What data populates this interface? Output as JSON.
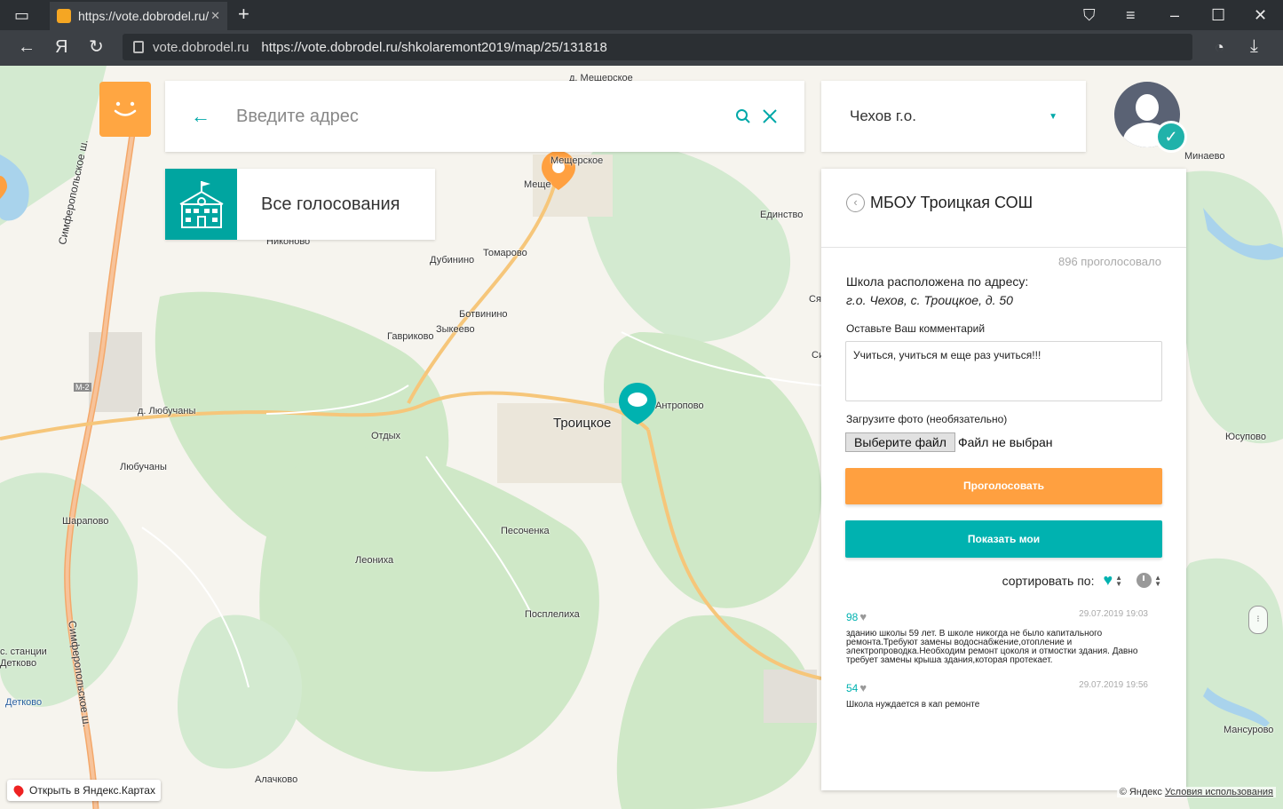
{
  "browser": {
    "tab_title": "https://vote.dobrodel.ru/",
    "tab_close": "✕",
    "new_tab": "+",
    "domain": "vote.dobrodel.ru",
    "url": "https://vote.dobrodel.ru/shkolaremont2019/map/25/131818",
    "yandex_glyph": "Я"
  },
  "search": {
    "placeholder": "Введите адрес",
    "back_glyph": "←"
  },
  "district": {
    "value": "Чехов г.о."
  },
  "all_votes": {
    "label": "Все голосования"
  },
  "panel": {
    "title": "МБОУ Троицкая СОШ",
    "vote_count": "896 проголосовало",
    "address_label": "Школа расположена по адресу:",
    "address_value": "г.о. Чехов, с. Троицкое, д. 50",
    "comment_label": "Оставьте Ваш комментарий",
    "comment_value": "Учиться, учиться м еще раз учиться!!!",
    "photo_label": "Загрузите фото (необязательно)",
    "file_button": "Выберите файл",
    "file_status": "Файл не выбран",
    "vote_button": "Проголосовать",
    "show_mine_button": "Показать мои",
    "sort_label": "сортировать по:"
  },
  "comments": [
    {
      "count": "98",
      "date": "29.07.2019 19:03",
      "text": "зданию школы 59 лет. В школе никогда не было капитального ремонта.Требуют замены водоснабжение,отопление и электропроводка.Необходим ремонт цоколя и отмостки здания. Давно требует замены крыша здания,которая протекает."
    },
    {
      "count": "54",
      "date": "29.07.2019 19:56",
      "text": "Школа нуждается в кап ремонте"
    }
  ],
  "map": {
    "places": [
      {
        "name": "д. Мещерское"
      },
      {
        "name": "Мещерское"
      },
      {
        "name": "Меще"
      },
      {
        "name": "Никоново"
      },
      {
        "name": "Дубинино"
      },
      {
        "name": "Томарово"
      },
      {
        "name": "Ботвинино"
      },
      {
        "name": "Гавриково"
      },
      {
        "name": "Зыкеево"
      },
      {
        "name": "Антропово"
      },
      {
        "name": "д. Любучаны"
      },
      {
        "name": "Любучаны"
      },
      {
        "name": "Отдых"
      },
      {
        "name": "Троицкое"
      },
      {
        "name": "Шарапово"
      },
      {
        "name": "Песоченка"
      },
      {
        "name": "Леониха"
      },
      {
        "name": "Посплелиха"
      },
      {
        "name": "с. станции"
      },
      {
        "name": "Детково"
      },
      {
        "name": "Детково"
      },
      {
        "name": "Алачково"
      },
      {
        "name": "Минаево"
      },
      {
        "name": "Единство"
      },
      {
        "name": "Юсупово"
      },
      {
        "name": "Мансурово"
      },
      {
        "name": "Ся"
      },
      {
        "name": "Си"
      },
      {
        "name": "Симферопольское ш."
      },
      {
        "name": "Симферопольское ш."
      },
      {
        "name": "М-2"
      }
    ],
    "open_yandex": "Открыть в Яндекс.Картах",
    "copyright": "© Яндекс",
    "terms": "Условия использования"
  },
  "colors": {
    "teal": "#00b2b0",
    "orange": "#ffa040",
    "forest": "#cfe8c7",
    "road": "#f6c67a"
  }
}
